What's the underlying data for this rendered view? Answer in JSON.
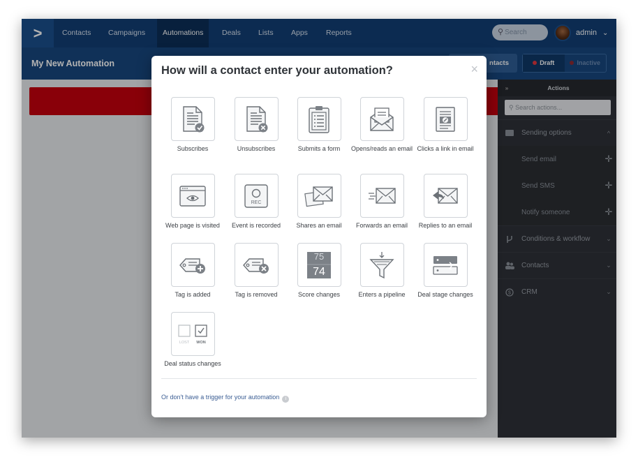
{
  "nav": {
    "brand_glyph": ">",
    "items": [
      {
        "label": "Contacts"
      },
      {
        "label": "Campaigns"
      },
      {
        "label": "Automations"
      },
      {
        "label": "Deals"
      },
      {
        "label": "Lists"
      },
      {
        "label": "Apps"
      },
      {
        "label": "Reports"
      }
    ],
    "active_item": "Automations",
    "search_placeholder": "Search",
    "user_label": "admin",
    "user_chevron": "⌄"
  },
  "header": {
    "title": "My New Automation",
    "contacts_button": "ntacts",
    "status": {
      "draft": "Draft",
      "inactive": "Inactive",
      "draft_color": "#e0373f",
      "inactive_color": "#c0303a"
    }
  },
  "panel": {
    "collapse_glyph": "»",
    "title": "Actions",
    "search_placeholder": "Search actions...",
    "sections": {
      "sending": {
        "label": "Sending options",
        "chevron": "^"
      },
      "conditions": {
        "label": "Conditions & workflow",
        "chevron": "⌄"
      },
      "contacts": {
        "label": "Contacts",
        "chevron": "⌄"
      },
      "crm": {
        "label": "CRM",
        "chevron": "⌄"
      }
    },
    "sending_items": [
      {
        "label": "Send email"
      },
      {
        "label": "Send SMS"
      },
      {
        "label": "Notify someone"
      }
    ],
    "add_glyph": "✛"
  },
  "modal": {
    "title": "How will a contact enter your automation?",
    "close_glyph": "×",
    "triggers": [
      {
        "label": "Subscribes",
        "icon": "document-check-icon"
      },
      {
        "label": "Unsubscribes",
        "icon": "document-x-icon"
      },
      {
        "label": "Submits a form",
        "icon": "clipboard-form-icon"
      },
      {
        "label": "Opens/reads an email",
        "icon": "open-envelope-icon"
      },
      {
        "label": "Clicks a link in email",
        "icon": "link-document-icon"
      },
      {
        "label": "Web page is visited",
        "icon": "browser-eye-icon"
      },
      {
        "label": "Event is recorded",
        "icon": "record-icon",
        "rec_text": "REC"
      },
      {
        "label": "Shares an email",
        "icon": "shared-envelopes-icon"
      },
      {
        "label": "Forwards an email",
        "icon": "forward-envelope-icon"
      },
      {
        "label": "Replies to an email",
        "icon": "reply-envelope-icon"
      },
      {
        "label": "Tag is added",
        "icon": "tag-add-icon"
      },
      {
        "label": "Tag is removed",
        "icon": "tag-remove-icon"
      },
      {
        "label": "Score changes",
        "icon": "score-icon",
        "score_top": "75",
        "score_bottom": "74"
      },
      {
        "label": "Enters a pipeline",
        "icon": "funnel-icon"
      },
      {
        "label": "Deal stage changes",
        "icon": "deal-stage-icon"
      },
      {
        "label": "Deal status changes",
        "icon": "lost-won-icon",
        "lost_text": "LOST",
        "won_text": "WON"
      }
    ],
    "no_trigger_link": "Or don't have a trigger for your automation",
    "info_glyph": "i"
  }
}
